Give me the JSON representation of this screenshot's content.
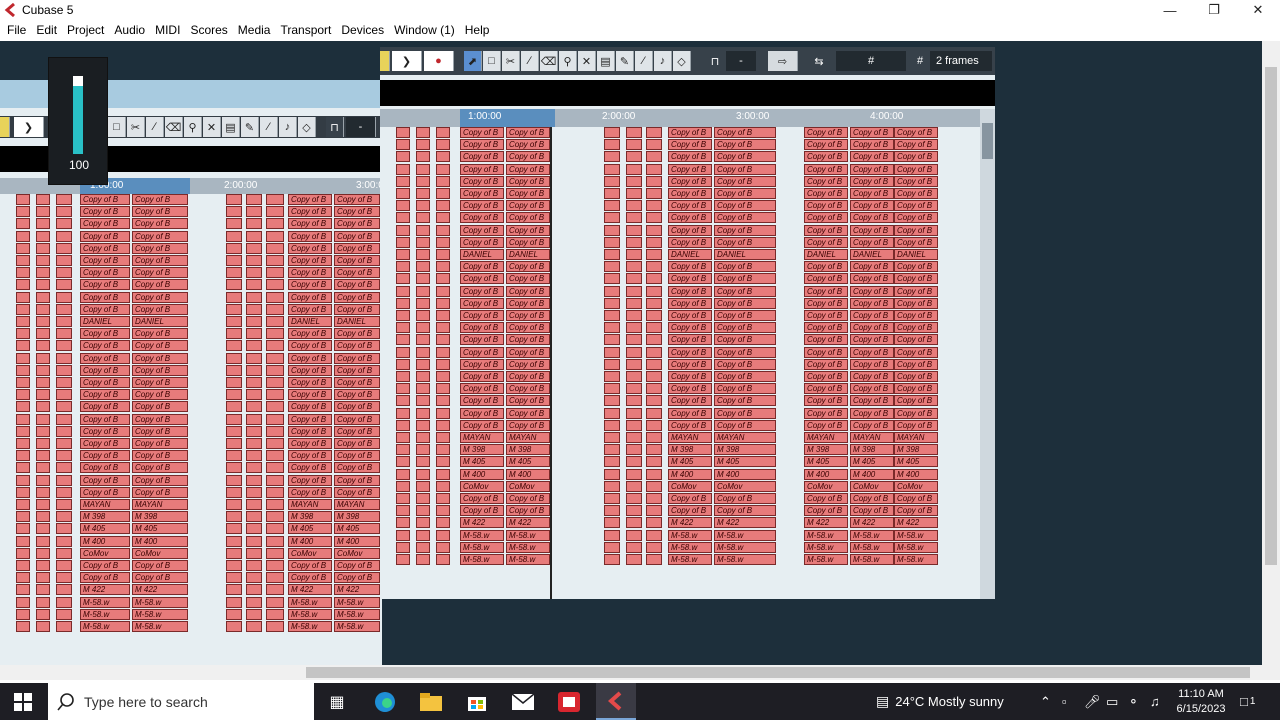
{
  "window": {
    "title": "Cubase 5"
  },
  "menu": [
    "File",
    "Edit",
    "Project",
    "Audio",
    "MIDI",
    "Scores",
    "Media",
    "Transport",
    "Devices",
    "Window (1)",
    "Help"
  ],
  "meter": {
    "value": "100",
    "level": 0.88
  },
  "toolbar": {
    "frames": "2 frames",
    "quantize": "-"
  },
  "front_ruler": [
    "1:00:00",
    "2:00:00",
    "3:00:00",
    "4:00:00"
  ],
  "back_ruler": [
    "1:00:00",
    "2:00:00",
    "3:00:0"
  ],
  "clip_labels": {
    "copy": "Copy of B",
    "daniel": "DANIEL",
    "mayan": "MAYAN",
    "m398": "M 398",
    "m405": "M 405",
    "m400": "M 400",
    "comov": "CoMov",
    "m422": "M 422",
    "m58": "M-58.w"
  },
  "taskbar": {
    "search_placeholder": "Type here to search",
    "weather": "24°C  Mostly sunny",
    "time": "11:10 AM",
    "date": "6/15/2023",
    "notif_count": "1"
  },
  "colors": {
    "clip": "#e77b7b",
    "toolbar": "#37414a",
    "workspace": "#1d2f3b",
    "meter": "#29c0c6"
  },
  "icons": [
    "windows-start-icon",
    "search-icon",
    "task-view-icon",
    "edge-icon",
    "file-explorer-icon",
    "store-icon",
    "mail-icon",
    "app-red-icon",
    "cubase-icon",
    "chevron-up-icon",
    "mic-icon",
    "battery-icon",
    "network-icon",
    "volume-icon",
    "notification-icon"
  ]
}
